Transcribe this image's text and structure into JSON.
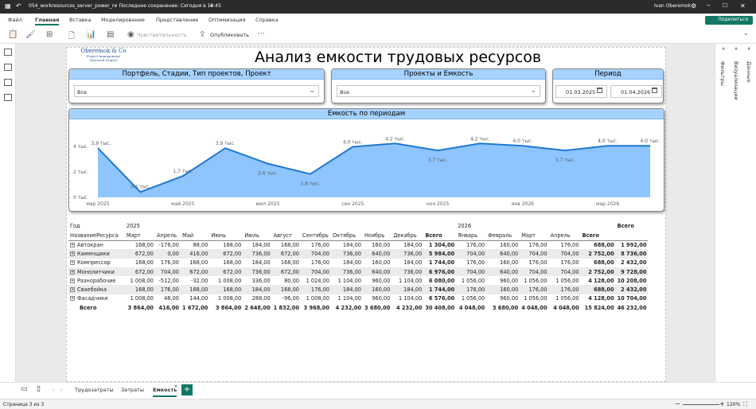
{
  "titlebar": {
    "file": "054_workresources_server_power_ru",
    "saved": "• Последнее сохранение: Сегодня в 18:45",
    "user": "Ivan Oberemok"
  },
  "menu": [
    "Файл",
    "Главная",
    "Вставка",
    "Моделирование",
    "Представление",
    "Оптимизация",
    "Справка"
  ],
  "share_label": "Поделиться",
  "toolbar": {
    "sensitivity": "Чувствительность",
    "publish": "Опубликовать",
    "more": "···"
  },
  "right_panes": {
    "filters": "Фильтры",
    "visualizations": "Визуализации",
    "data": "Данные"
  },
  "logo": {
    "line1": "Oberemok & Co",
    "line2": "Project management",
    "line3": "Microsoft Project"
  },
  "report_title": "Анализ емкости трудовых ресурсов",
  "slicers": {
    "portfolio": {
      "title": "Портфель, Стадии, Тип проектов, Проект",
      "value": "Все"
    },
    "projects": {
      "title": "Проекты и Емкость",
      "value": "Все"
    },
    "period": {
      "title": "Период",
      "from": "01.03.2025",
      "to": "01.04.2026"
    }
  },
  "chart_data": {
    "type": "area",
    "title": "Емкость по периодам",
    "x": [
      "мар 2025",
      "апр 2025",
      "май 2025",
      "июн 2025",
      "июл 2025",
      "авг 2025",
      "сен 2025",
      "окт 2025",
      "ноя 2025",
      "дек 2025",
      "янв 2026",
      "фев 2026",
      "мар 2026",
      "апр 2026"
    ],
    "values": [
      3864,
      416,
      1672,
      3864,
      2648,
      1832,
      3968,
      4232,
      3680,
      4232,
      4048,
      3680,
      4048,
      4048
    ],
    "data_labels": [
      "3,9 тыс.",
      "0,4 тыс.",
      "1,7 тыс.",
      "3,9 тыс.",
      "2,6 тыс.",
      "1,8 тыс.",
      "4,0 тыс.",
      "4,2 тыс.",
      "3,7 тыс.",
      "4,2 тыс.",
      "4,0 тыс.",
      "3,7 тыс.",
      "4,0 тыс.",
      "4,0 тыс."
    ],
    "x_ticks": [
      "мар 2025",
      "май 2025",
      "июл 2025",
      "сен 2025",
      "ноя 2025",
      "янв 2026",
      "мар 2026"
    ],
    "y_ticks": [
      "0 тыс.",
      "2 тыс.",
      "4 тыс."
    ],
    "ylim": [
      0,
      5000
    ],
    "color": "#8ec5ff",
    "line_color": "#1f78d1"
  },
  "matrix": {
    "corner_year": "Год",
    "corner_name": "НазваниеРесурса",
    "years": [
      "2025",
      "2026",
      "Всего"
    ],
    "months": [
      "Март",
      "Апрель",
      "Май",
      "Июнь",
      "Июль",
      "Август",
      "Сентябрь",
      "Октябрь",
      "Ноябрь",
      "Декабрь",
      "Всего",
      "Январь",
      "Февраль",
      "Март",
      "Апрель",
      "Всего"
    ],
    "rows": [
      {
        "name": "Автокран",
        "values": [
          "168,00",
          "-176,00",
          "88,00",
          "168,00",
          "184,00",
          "168,00",
          "176,00",
          "184,00",
          "160,00",
          "184,00",
          "1 304,00",
          "176,00",
          "160,00",
          "176,00",
          "176,00",
          "688,00",
          "1 992,00"
        ]
      },
      {
        "name": "Каменщики",
        "values": [
          "672,00",
          "0,00",
          "416,00",
          "672,00",
          "736,00",
          "672,00",
          "704,00",
          "736,00",
          "640,00",
          "736,00",
          "5 984,00",
          "704,00",
          "640,00",
          "704,00",
          "704,00",
          "2 752,00",
          "8 736,00"
        ]
      },
      {
        "name": "Компрессор",
        "values": [
          "168,00",
          "176,00",
          "168,00",
          "168,00",
          "184,00",
          "168,00",
          "176,00",
          "184,00",
          "160,00",
          "184,00",
          "1 744,00",
          "176,00",
          "160,00",
          "176,00",
          "176,00",
          "688,00",
          "2 432,00"
        ]
      },
      {
        "name": "Монолитчики",
        "values": [
          "672,00",
          "704,00",
          "672,00",
          "672,00",
          "736,00",
          "672,00",
          "704,00",
          "736,00",
          "640,00",
          "736,00",
          "6 976,00",
          "704,00",
          "640,00",
          "704,00",
          "704,00",
          "2 752,00",
          "9 728,00"
        ]
      },
      {
        "name": "Разнорабочие",
        "values": [
          "1 008,00",
          "-512,00",
          "-32,00",
          "1 008,00",
          "336,00",
          "80,00",
          "1 024,00",
          "1 104,00",
          "960,00",
          "1 104,00",
          "6 080,00",
          "1 056,00",
          "960,00",
          "1 056,00",
          "1 056,00",
          "4 128,00",
          "10 208,00"
        ]
      },
      {
        "name": "Сваебойка",
        "values": [
          "168,00",
          "176,00",
          "168,00",
          "168,00",
          "184,00",
          "168,00",
          "176,00",
          "184,00",
          "160,00",
          "184,00",
          "1 744,00",
          "176,00",
          "160,00",
          "176,00",
          "176,00",
          "688,00",
          "2 432,00"
        ]
      },
      {
        "name": "Фасадчики",
        "values": [
          "1 008,00",
          "48,00",
          "144,00",
          "1 008,00",
          "288,00",
          "-96,00",
          "1 008,00",
          "1 104,00",
          "960,00",
          "1 104,00",
          "6 576,00",
          "1 056,00",
          "960,00",
          "1 056,00",
          "1 056,00",
          "4 128,00",
          "10 704,00"
        ]
      }
    ],
    "total": {
      "name": "Всего",
      "values": [
        "3 864,00",
        "416,00",
        "1 672,00",
        "3 864,00",
        "2 648,00",
        "1 832,00",
        "3 968,00",
        "4 232,00",
        "3 680,00",
        "4 232,00",
        "30 408,00",
        "4 048,00",
        "3 680,00",
        "4 048,00",
        "4 048,00",
        "15 824,00",
        "46 232,00"
      ]
    }
  },
  "tabs": [
    "Трудозатраты",
    "Затраты",
    "Емкость"
  ],
  "status": {
    "page": "Страница 3 из 3",
    "zoom": "120%"
  }
}
